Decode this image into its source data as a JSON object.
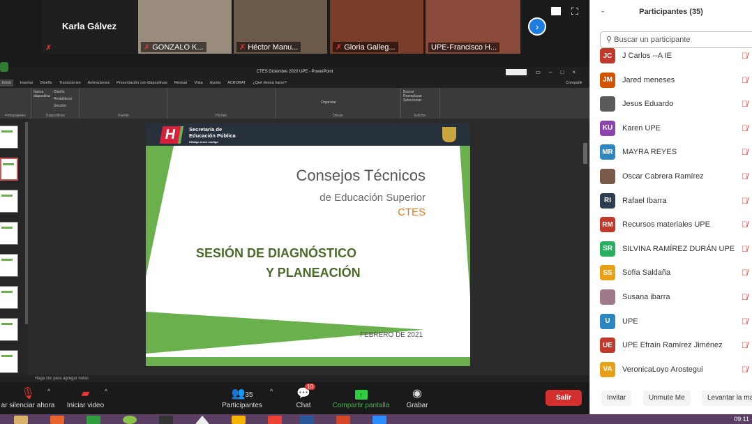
{
  "videos": [
    {
      "name": "Karla Gálvez",
      "type": "name-only"
    },
    {
      "name": "GONZALO K...",
      "bg": "#9a8c7c"
    },
    {
      "name": "Héctor Manu...",
      "bg": "#6b5a4a"
    },
    {
      "name": "Gloria Galleg...",
      "bg": "#7a3d2a"
    },
    {
      "name": "UPE-Francisco H...",
      "bg": "#8a4a3a"
    }
  ],
  "ppt": {
    "title": "CTES Diciembre 2020 UPE  -  PowerPoint",
    "tabs": [
      "Inicio",
      "Insertar",
      "Diseño",
      "Transiciones",
      "Animaciones",
      "Presentación con diapositivas",
      "Revisar",
      "Vista",
      "Ayuda",
      "ACROBAT",
      "¿Qué desea hacer?"
    ],
    "share": "Compartir",
    "groups": [
      "Portapapeles",
      "Diapositivas",
      "Fuente",
      "Párrafo",
      "Dibujo",
      "Edición"
    ],
    "ribbon_items": {
      "nueva": "Nueva diapositiva",
      "diseno": "Diseño",
      "restablecer": "Restablecer",
      "seccion": "Sección",
      "organizar": "Organizar",
      "buscar": "Buscar",
      "reemplazar": "Reemplazar",
      "seleccionar": "Seleccionar"
    },
    "notes_placeholder": "Haga clic para agregar notas",
    "slide": {
      "org_line1": "Secretaría de",
      "org_line2": "Educación Pública",
      "org_tagline": "Hidalgo crece contigo",
      "title": "Consejos Técnicos",
      "subtitle": "de Educación Superior",
      "acronym": "CTES",
      "session_line1": "SESIÓN DE DIAGNÓSTICO",
      "session_line2": "Y PLANEACIÓN",
      "date": "FEBRERO DE 2021"
    }
  },
  "toolbar": {
    "mute": "ar silenciar ahora",
    "video": "Iniciar video",
    "participants": "Participantes",
    "participants_count": "35",
    "chat": "Chat",
    "chat_badge": "10",
    "share": "Compartir pantalla",
    "record": "Grabar",
    "leave": "Salir"
  },
  "panel": {
    "title": "Participantes (35)",
    "search_placeholder": "Buscar un participante",
    "participants": [
      {
        "initials": "JC",
        "name": "J Carlos --A IE",
        "color": "#c0392b"
      },
      {
        "initials": "JM",
        "name": "Jared meneses",
        "color": "#d35400"
      },
      {
        "initials": "",
        "name": "Jesus Eduardo",
        "color": "#5a5a5a"
      },
      {
        "initials": "KU",
        "name": "Karen UPE",
        "color": "#8e44ad"
      },
      {
        "initials": "MR",
        "name": "MAYRA REYES",
        "color": "#2e86c1"
      },
      {
        "initials": "",
        "name": "Oscar Cabrera Ramírez",
        "color": "#7a5a4a"
      },
      {
        "initials": "RI",
        "name": "Rafael Ibarra",
        "color": "#2c3e50"
      },
      {
        "initials": "RM",
        "name": "Recursos materiales UPE",
        "color": "#c0392b"
      },
      {
        "initials": "SR",
        "name": "SILVINA RAMÍREZ DURÁN UPE",
        "color": "#27ae60"
      },
      {
        "initials": "SS",
        "name": "Sofía Saldaña",
        "color": "#e6a117"
      },
      {
        "initials": "",
        "name": "Susana ibarra",
        "color": "#a07a8a"
      },
      {
        "initials": "U",
        "name": "UPE",
        "color": "#2e86c1"
      },
      {
        "initials": "UE",
        "name": "UPE Efraín Ramírez Jiménez",
        "color": "#c0392b"
      },
      {
        "initials": "VA",
        "name": "VeronicaLoyo Arostegui",
        "color": "#e6a117"
      }
    ],
    "buttons": [
      "Invitar",
      "Unmute Me",
      "Levantar la ma"
    ]
  },
  "taskbar": {
    "clock": "09:11"
  },
  "colors": {
    "green": "#6ab04c",
    "slide_text": "#555555",
    "accent_orange": "#e07b1a",
    "session_green": "#4a6b2a",
    "leave": "#d32f2f"
  }
}
